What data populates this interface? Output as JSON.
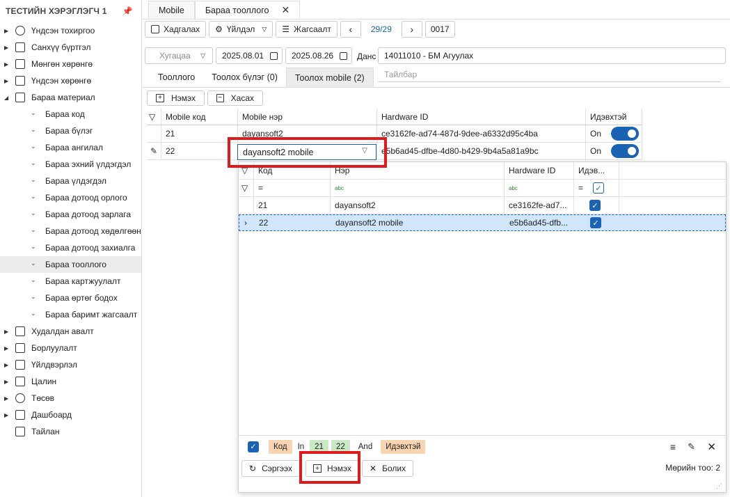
{
  "sidebar": {
    "title": "ТЕСТИЙН ХЭРЭГЛЭГЧ 1",
    "pin_icon": "pin-icon",
    "items_top": [
      {
        "label": "Үндсэн тохиргоо",
        "icon": "gear-icon"
      },
      {
        "label": "Санхүү бүртгэл",
        "icon": "book-icon"
      },
      {
        "label": "Мөнгөн хөрөнгө",
        "icon": "cash-icon"
      },
      {
        "label": "Үндсэн хөрөнгө",
        "icon": "box-icon"
      },
      {
        "label": "Бараа материал",
        "icon": "inventory-icon"
      }
    ],
    "sub_items": [
      "Бараа код",
      "Бараа бүлэг",
      "Бараа ангилал",
      "Бараа эхний үлдэгдэл",
      "Бараа үлдэгдэл",
      "Бараа дотоод орлого",
      "Бараа дотоод зарлага",
      "Бараа дотоод хөдөлгөөн",
      "Бараа дотоод захиалга",
      "Бараа тооллого",
      "Бараа картжуулалт",
      "Бараа өртөг бодох",
      "Бараа баримт жагсаалт"
    ],
    "active_sub": "Бараа тооллого",
    "items_bottom": [
      {
        "label": "Худалдан авалт",
        "icon": "truck-icon"
      },
      {
        "label": "Борлуулалт",
        "icon": "cart-icon"
      },
      {
        "label": "Үйлдвэрлэл",
        "icon": "factory-icon"
      },
      {
        "label": "Цалин",
        "icon": "calculator-icon"
      },
      {
        "label": "Төсөв",
        "icon": "pie-icon"
      },
      {
        "label": "Дашбоард",
        "icon": "chart-icon"
      },
      {
        "label": "Тайлан",
        "icon": "report-icon"
      }
    ]
  },
  "doc_tabs": [
    "Mobile",
    "Бараа тооллого"
  ],
  "toolbar": {
    "save": "Хадгалах",
    "action": "Үйлдэл",
    "list": "Жагсаалт",
    "page": "29/29",
    "doc_no": "0017"
  },
  "filters": {
    "period_placeholder": "Хугацаа",
    "date_from": "2025.08.01",
    "date_to": "2025.08.26",
    "account_label": "Данс",
    "account_value": "14011010 - БМ Агуулах",
    "description_placeholder": "Тайлбар"
  },
  "inner_tabs": [
    "Тооллого",
    "Тоолох бүлэг (0)",
    "Тоолох mobile (2)"
  ],
  "actions": {
    "add": "Нэмэх",
    "remove": "Хасах"
  },
  "grid": {
    "columns": [
      "Mobile код",
      "Mobile нэр",
      "Hardware ID",
      "Идэвхтэй"
    ],
    "rows": [
      {
        "code": "21",
        "name": "dayansoft2",
        "hw": "ce3162fe-ad74-487d-9dee-a6332d95c4ba",
        "active": "On"
      },
      {
        "code": "22",
        "name": "dayansoft2 mobile",
        "hw": "e5b6ad45-dfbe-4d80-b429-9b4a5a81a9bc",
        "active": "On"
      }
    ]
  },
  "popup": {
    "columns": [
      "Код",
      "Нэр",
      "Hardware ID",
      "Идэв..."
    ],
    "filter_ops": [
      "=",
      "abc",
      "abc",
      "="
    ],
    "rows": [
      {
        "code": "21",
        "name": "dayansoft2",
        "hw": "ce3162fe-ad7..."
      },
      {
        "code": "22",
        "name": "dayansoft2 mobile",
        "hw": "e5b6ad45-dfb..."
      }
    ],
    "filter_bar": {
      "field1": "Код",
      "op1": "In",
      "vals": [
        "21",
        "22"
      ],
      "and": "And",
      "field2": "Идэвхтэй"
    },
    "buttons": {
      "refresh": "Сэргээх",
      "add": "Нэмэх",
      "cancel": "Болих"
    },
    "row_count": "Мөрийн тоо: 2"
  }
}
